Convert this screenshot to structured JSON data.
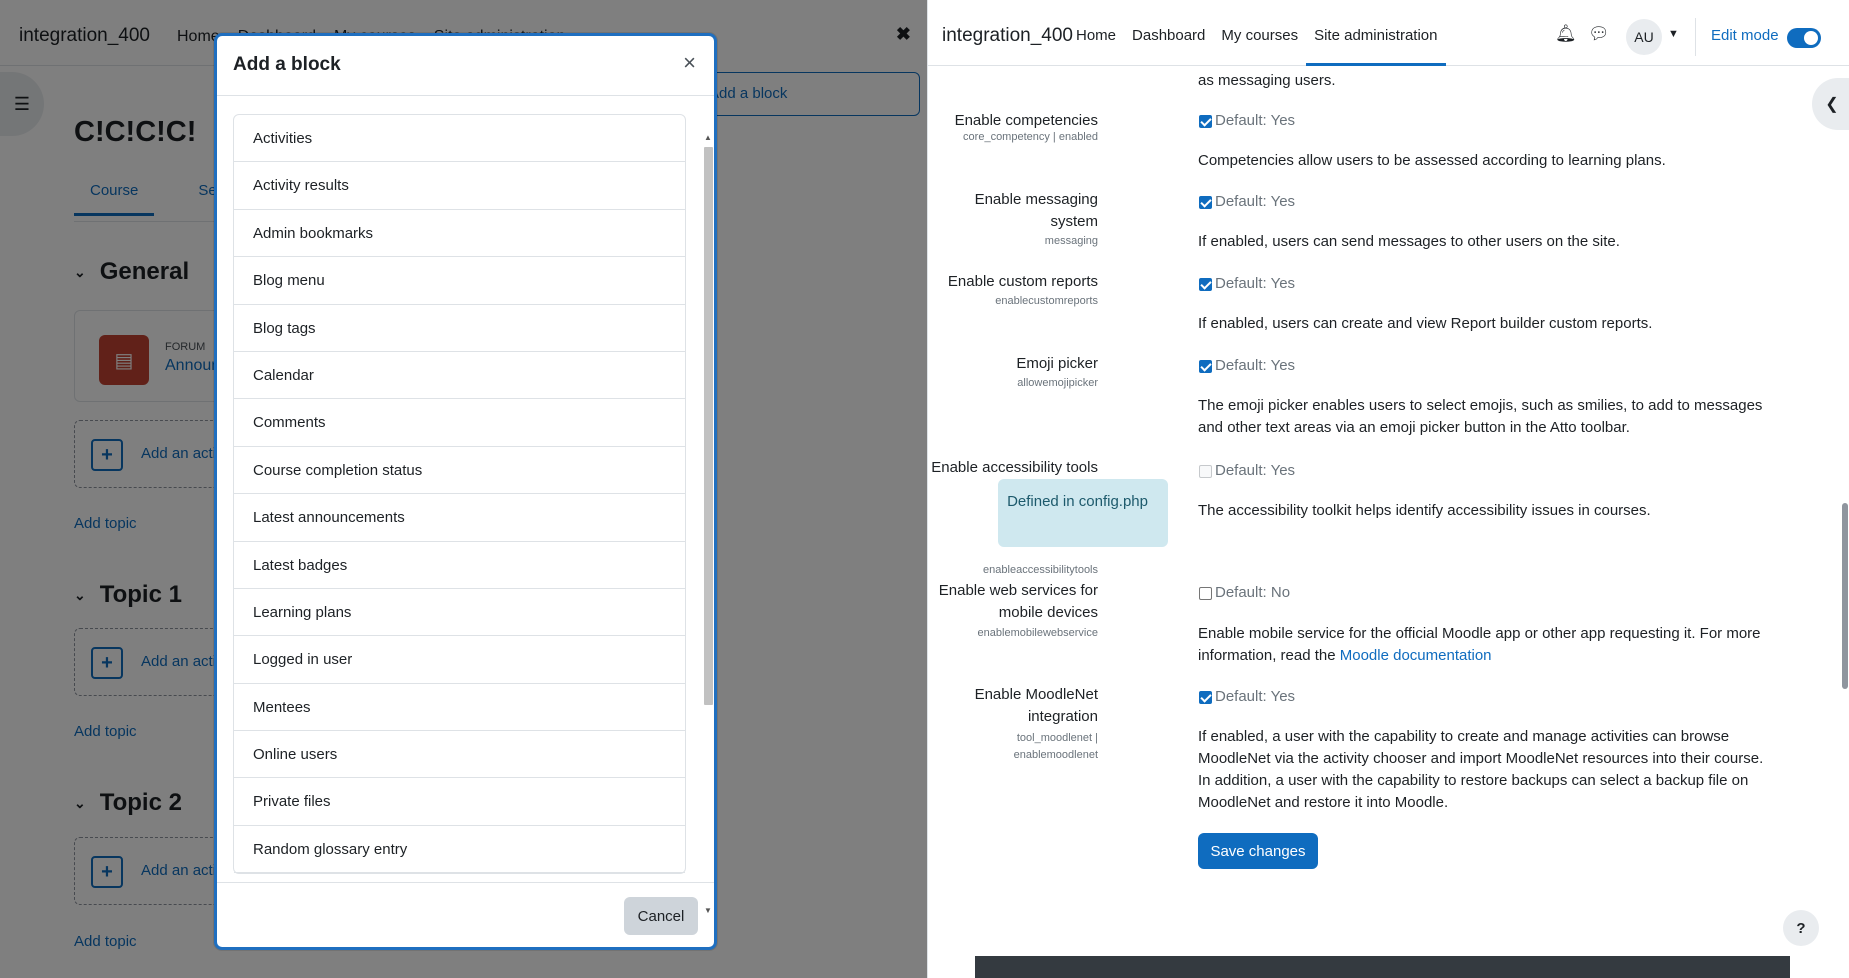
{
  "left": {
    "brand": "integration_400",
    "nav": [
      "Home",
      "Dashboard",
      "My courses",
      "Site administration"
    ],
    "course_title": "C!C!C!C!",
    "tabs": [
      "Course",
      "Settings"
    ],
    "sections": [
      {
        "title": "General"
      },
      {
        "title": "Topic 1"
      },
      {
        "title": "Topic 2"
      }
    ],
    "forum_type": "FORUM",
    "forum_name": "Announcements",
    "add_activity": "Add an activity or resource",
    "add_topic": "Add topic",
    "add_block_button": "Add a block"
  },
  "modal": {
    "title": "Add a block",
    "items": [
      "Activities",
      "Activity results",
      "Admin bookmarks",
      "Blog menu",
      "Blog tags",
      "Calendar",
      "Comments",
      "Course completion status",
      "Latest announcements",
      "Latest badges",
      "Learning plans",
      "Logged in user",
      "Mentees",
      "Online users",
      "Private files",
      "Random glossary entry"
    ],
    "cancel": "Cancel"
  },
  "right": {
    "brand": "integration_400",
    "nav": [
      "Home",
      "Dashboard",
      "My courses",
      "Site administration"
    ],
    "active_nav": "Site administration",
    "avatar": "AU",
    "edit_mode": "Edit mode",
    "top_fragment": "as messaging users.",
    "settings": [
      {
        "label": "Enable competencies",
        "key": "core_competency | enabled",
        "checked": true,
        "default": "Default: Yes",
        "desc": "Competencies allow users to be assessed according to learning plans."
      },
      {
        "label": "Enable messaging system",
        "key": "messaging",
        "checked": true,
        "default": "Default: Yes",
        "desc": "If enabled, users can send messages to other users on the site."
      },
      {
        "label": "Enable custom reports",
        "key": "enablecustomreports",
        "checked": true,
        "default": "Default: Yes",
        "desc": "If enabled, users can create and view Report builder custom reports."
      },
      {
        "label": "Emoji picker",
        "key": "allowemojipicker",
        "checked": true,
        "default": "Default: Yes",
        "desc": "The emoji picker enables users to select emojis, such as smilies, to add to messages and other text areas via an emoji picker button in the Atto toolbar."
      },
      {
        "label": "Enable accessibility tools",
        "key": "enableaccessibilitytools",
        "checked": false,
        "disabled": true,
        "config_note": "Defined in config.php",
        "default": "Default: Yes",
        "desc": "The accessibility toolkit helps identify accessibility issues in courses."
      },
      {
        "label": "Enable web services for mobile devices",
        "key": "enablemobilewebservice",
        "checked": false,
        "default": "Default: No",
        "desc": "Enable mobile service for the official Moodle app or other app requesting it. For more information, read the",
        "link": "Moodle documentation"
      },
      {
        "label": "Enable MoodleNet integration",
        "key": "tool_moodlenet | enablemoodlenet",
        "checked": true,
        "default": "Default: Yes",
        "desc": "If enabled, a user with the capability to create and manage activities can browse MoodleNet via the activity chooser and import MoodleNet resources into their course. In addition, a user with the capability to restore backups can select a backup file on MoodleNet and restore it into Moodle."
      }
    ],
    "save": "Save changes",
    "help": "?"
  }
}
